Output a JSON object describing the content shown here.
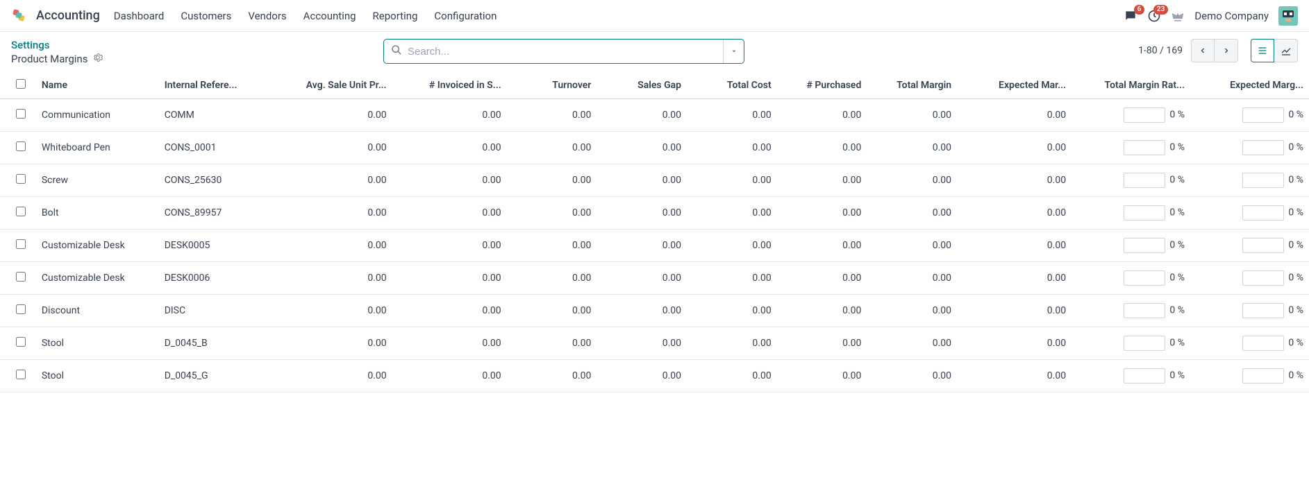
{
  "navbar": {
    "app_name": "Accounting",
    "menu": [
      "Dashboard",
      "Customers",
      "Vendors",
      "Accounting",
      "Reporting",
      "Configuration"
    ],
    "messages_badge": "6",
    "activities_badge": "23",
    "company": "Demo Company"
  },
  "breadcrumb": {
    "parent": "Settings",
    "current": "Product Margins"
  },
  "search": {
    "placeholder": "Search..."
  },
  "pager": {
    "range": "1-80",
    "total": "169",
    "sep": " / "
  },
  "columns": [
    "Name",
    "Internal Refere...",
    "Avg. Sale Unit Pr...",
    "# Invoiced in S...",
    "Turnover",
    "Sales Gap",
    "Total Cost",
    "# Purchased",
    "Total Margin",
    "Expected Mar...",
    "Total Margin Rat...",
    "Expected Marg..."
  ],
  "rows": [
    {
      "name": "Communication",
      "ref": "COMM",
      "avg": "0.00",
      "inv": "0.00",
      "turn": "0.00",
      "gap": "0.00",
      "cost": "0.00",
      "purch": "0.00",
      "tmargin": "0.00",
      "emargin": "0.00",
      "trate": "0 %",
      "erate": "0 %"
    },
    {
      "name": "Whiteboard Pen",
      "ref": "CONS_0001",
      "avg": "0.00",
      "inv": "0.00",
      "turn": "0.00",
      "gap": "0.00",
      "cost": "0.00",
      "purch": "0.00",
      "tmargin": "0.00",
      "emargin": "0.00",
      "trate": "0 %",
      "erate": "0 %"
    },
    {
      "name": "Screw",
      "ref": "CONS_25630",
      "avg": "0.00",
      "inv": "0.00",
      "turn": "0.00",
      "gap": "0.00",
      "cost": "0.00",
      "purch": "0.00",
      "tmargin": "0.00",
      "emargin": "0.00",
      "trate": "0 %",
      "erate": "0 %"
    },
    {
      "name": "Bolt",
      "ref": "CONS_89957",
      "avg": "0.00",
      "inv": "0.00",
      "turn": "0.00",
      "gap": "0.00",
      "cost": "0.00",
      "purch": "0.00",
      "tmargin": "0.00",
      "emargin": "0.00",
      "trate": "0 %",
      "erate": "0 %"
    },
    {
      "name": "Customizable Desk",
      "ref": "DESK0005",
      "avg": "0.00",
      "inv": "0.00",
      "turn": "0.00",
      "gap": "0.00",
      "cost": "0.00",
      "purch": "0.00",
      "tmargin": "0.00",
      "emargin": "0.00",
      "trate": "0 %",
      "erate": "0 %"
    },
    {
      "name": "Customizable Desk",
      "ref": "DESK0006",
      "avg": "0.00",
      "inv": "0.00",
      "turn": "0.00",
      "gap": "0.00",
      "cost": "0.00",
      "purch": "0.00",
      "tmargin": "0.00",
      "emargin": "0.00",
      "trate": "0 %",
      "erate": "0 %"
    },
    {
      "name": "Discount",
      "ref": "DISC",
      "avg": "0.00",
      "inv": "0.00",
      "turn": "0.00",
      "gap": "0.00",
      "cost": "0.00",
      "purch": "0.00",
      "tmargin": "0.00",
      "emargin": "0.00",
      "trate": "0 %",
      "erate": "0 %"
    },
    {
      "name": "Stool",
      "ref": "D_0045_B",
      "avg": "0.00",
      "inv": "0.00",
      "turn": "0.00",
      "gap": "0.00",
      "cost": "0.00",
      "purch": "0.00",
      "tmargin": "0.00",
      "emargin": "0.00",
      "trate": "0 %",
      "erate": "0 %"
    },
    {
      "name": "Stool",
      "ref": "D_0045_G",
      "avg": "0.00",
      "inv": "0.00",
      "turn": "0.00",
      "gap": "0.00",
      "cost": "0.00",
      "purch": "0.00",
      "tmargin": "0.00",
      "emargin": "0.00",
      "trate": "0 %",
      "erate": "0 %"
    }
  ]
}
